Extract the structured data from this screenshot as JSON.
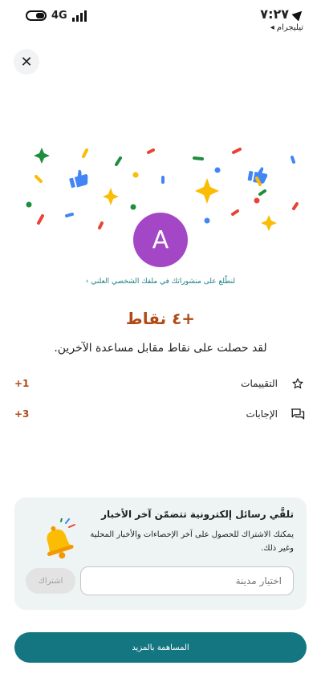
{
  "status_bar": {
    "network": "4G",
    "time": "٧:٢٧",
    "back_app": "◂ تيليجرام"
  },
  "close_icon": "close-icon",
  "avatar_letter": "A",
  "profile_link": "لنطّلع على منشوراتك في ملفك الشخصي العلني ›",
  "points_title": "+٤ نقاط",
  "points_description": "لقد حصلت على نقاط مقابل مساعدة الآخرين.",
  "breakdown": [
    {
      "label": "التقييمات",
      "value": "+1",
      "icon": "star-icon"
    },
    {
      "label": "الإجابات",
      "value": "+3",
      "icon": "answers-icon"
    }
  ],
  "newsletter": {
    "title": "تلقَّي رسائل إلكترونية تتضمّن آخر الأخبار",
    "description": "يمكنك الاشتراك للحصول على آخر الإحصاءات والأخبار المحلية وغير ذلك.",
    "city_placeholder": "اختيار مدينة",
    "subscribe_label": "اشتراك"
  },
  "contribute_label": "المساهمة بالمزيد",
  "colors": {
    "accent": "#137681",
    "points": "#b04a14",
    "avatar": "#a447c6",
    "card_bg": "#eef4f3"
  }
}
